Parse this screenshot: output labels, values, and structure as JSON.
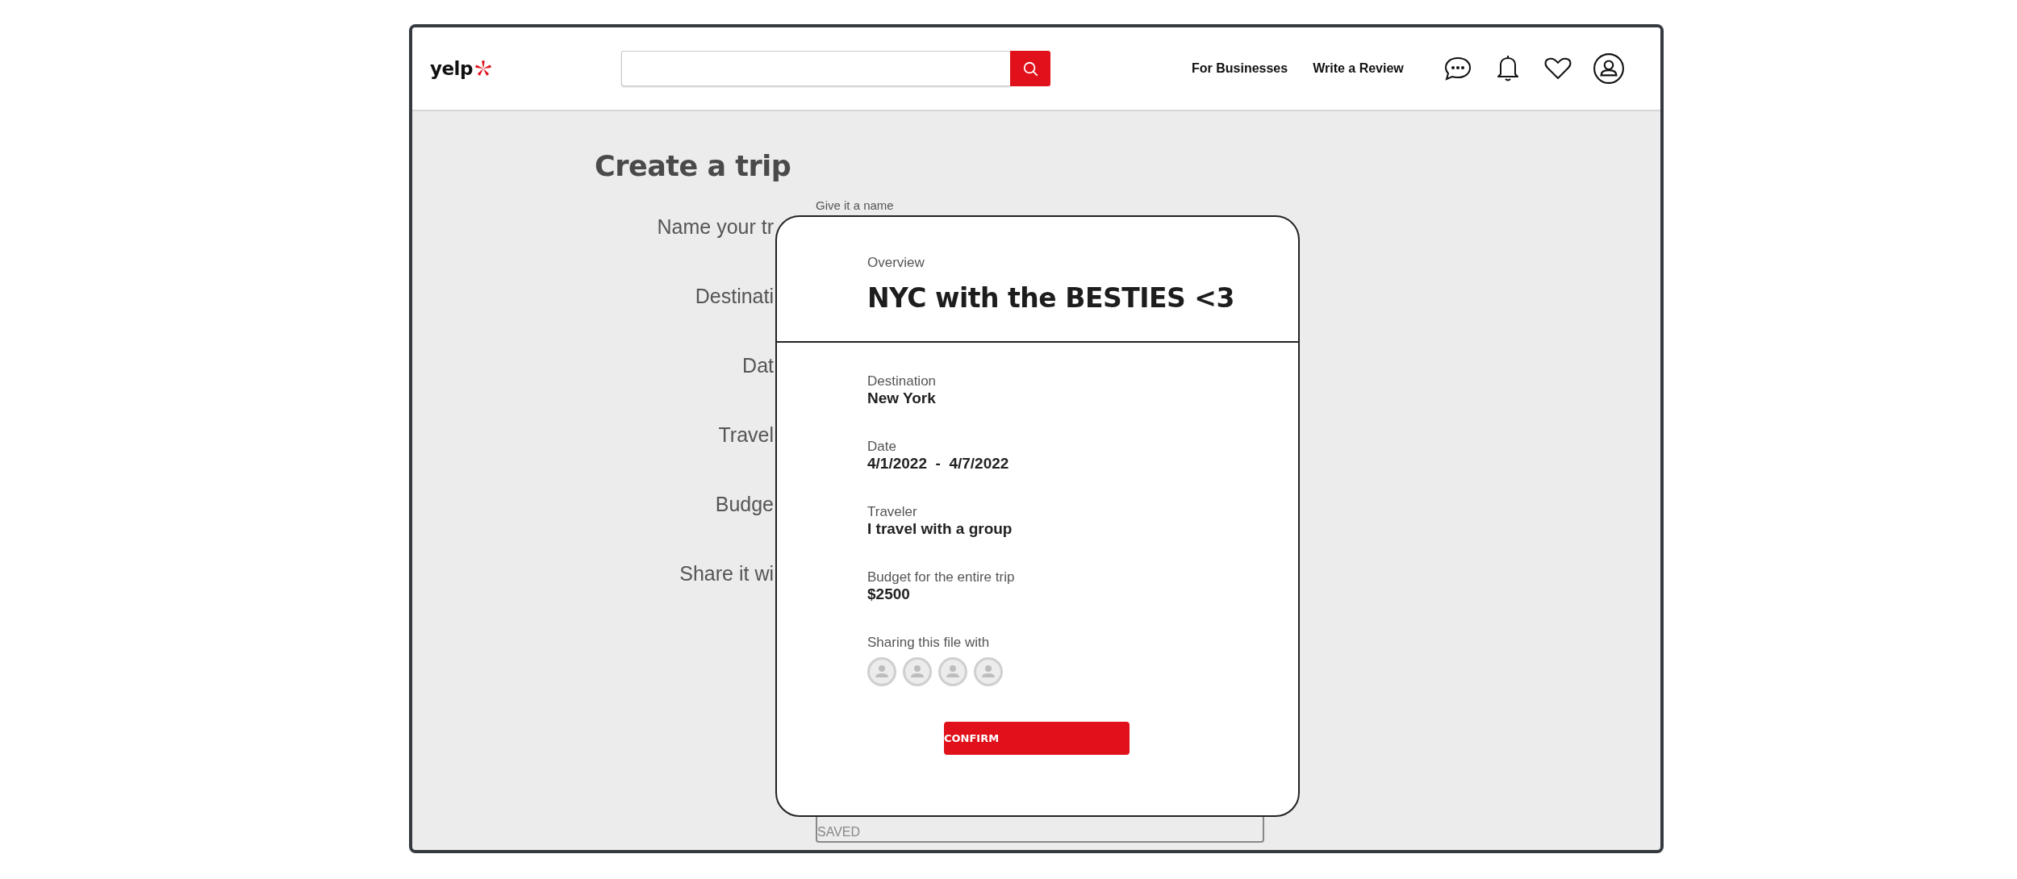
{
  "header": {
    "logo": "yelp",
    "search": {
      "kind": "empty"
    },
    "links": [
      "For Businesses",
      "Write a Review"
    ]
  },
  "form": {
    "title": "Create a trip",
    "name_hint": "Give it a name",
    "labels": [
      "Name your tr",
      "Destinati",
      "Dat",
      "Travel",
      "Budge",
      "Share it wi"
    ],
    "saved_field": "SAVED"
  },
  "modal": {
    "overline": "Overview",
    "title": "NYC with the BESTIES <3",
    "details": [
      {
        "label": "Destination",
        "value": "New York"
      },
      {
        "label": "Date",
        "value": "4/1/2022  -  4/7/2022"
      },
      {
        "label": "Traveler",
        "value": "I travel with a group"
      },
      {
        "label": "Budget for the entire trip",
        "value": "$2500"
      }
    ],
    "sharing": {
      "label": "Sharing this file with",
      "avatars": [
        {
          "kind": "placeholder"
        },
        {
          "kind": "placeholder"
        },
        {
          "kind": "placeholder"
        },
        {
          "kind": "placeholder"
        }
      ]
    },
    "button": "CONFIRM"
  }
}
